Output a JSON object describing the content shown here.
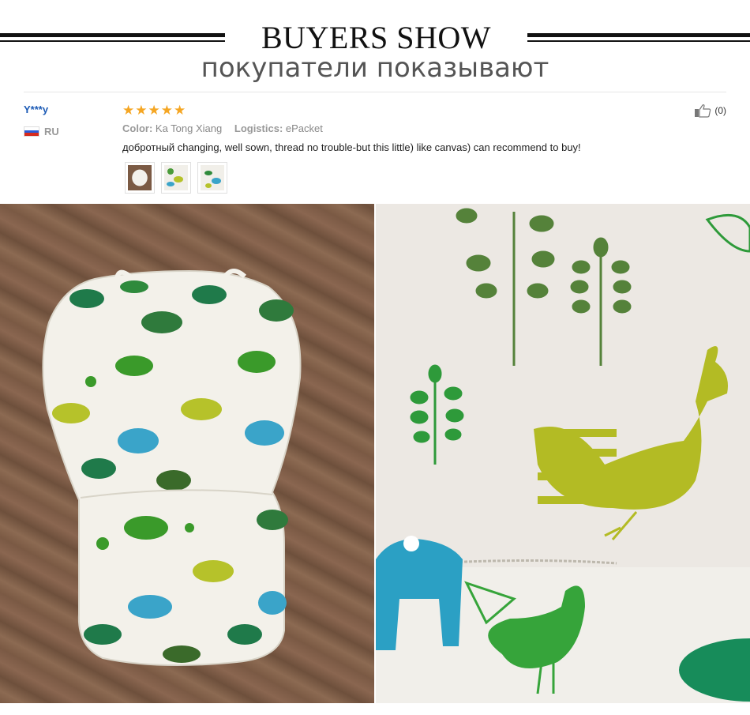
{
  "header": {
    "title": "BUYERS SHOW",
    "subtitle": "покупатели показывают"
  },
  "review": {
    "user": "Y***y",
    "country_code": "RU",
    "stars": 5,
    "color_label": "Color:",
    "color_value": "Ka Tong Xiang",
    "logistics_label": "Logistics:",
    "logistics_value": "ePacket",
    "text": "добротный changing, well sown, thread no trouble-but this little) like canvas) can recommend to buy!",
    "helpful_count": "(0)",
    "thumbnails": [
      "thumbnail-1",
      "thumbnail-2",
      "thumbnail-3"
    ]
  },
  "icons": {
    "star": "star-icon",
    "flag": "russia-flag-icon",
    "like": "thumbs-up-icon"
  },
  "colors": {
    "username": "#1a59b5",
    "stars": "#f5a623",
    "meta": "#999999",
    "rule": "#111111"
  }
}
